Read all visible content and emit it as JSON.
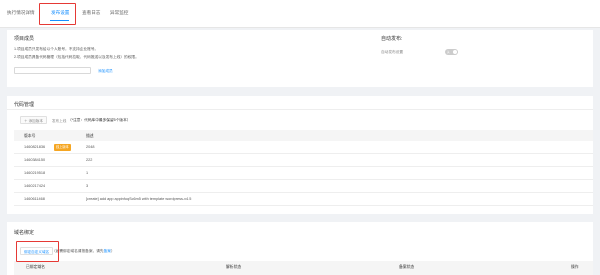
{
  "tabs": [
    {
      "label": "执行情况详情"
    },
    {
      "label": "发布设置"
    },
    {
      "label": "查看日志"
    },
    {
      "label": "异常监控"
    }
  ],
  "members": {
    "title": "项目成员",
    "note1": "1.项目成员只发布给以个人账号，不支持企业账号。",
    "note2": "2.项目成员具备代码管理（包括代码拉取、代码推送以及发布上线）的权限。",
    "input_placeholder": "",
    "add_label": "添加成员"
  },
  "auto_release": {
    "title": "自动发布:",
    "label": "自动发布设置",
    "switch_text": "关"
  },
  "code": {
    "title": "代码管理",
    "add_version_label": "添加版本",
    "unpublish_label": "发布上线",
    "hint": "（*注意：代码库中最多保留5个版本）",
    "columns": [
      "版本号",
      "描述"
    ],
    "rows": [
      {
        "version": "1460821836",
        "badge": "线上版本",
        "desc": "2048"
      },
      {
        "version": "1460384150",
        "badge": "",
        "desc": "222"
      },
      {
        "version": "1460219518",
        "badge": "",
        "desc": "1"
      },
      {
        "version": "1460217424",
        "badge": "",
        "desc": "3"
      },
      {
        "version": "1460611468",
        "badge": "",
        "desc": "[create] add app appinfoqSc6m5 with template wordpress-v4.5"
      }
    ]
  },
  "domain": {
    "title": "域名绑定",
    "bind_button": "绑定自定义域名",
    "hint_prefix": "（如需绑定域名请按备案，请先",
    "hint_link": "备案",
    "hint_suffix": "）",
    "columns": [
      "已绑定域名",
      "解析状态",
      "备案状态",
      "操作"
    ]
  },
  "colors": {
    "accent": "#1890ff",
    "highlight": "#e53935",
    "badge": "#f5a623"
  }
}
